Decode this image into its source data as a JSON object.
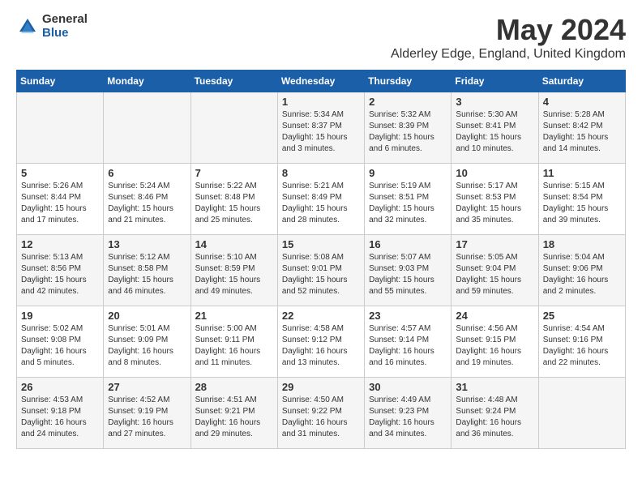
{
  "logo": {
    "general": "General",
    "blue": "Blue"
  },
  "title": "May 2024",
  "location": "Alderley Edge, England, United Kingdom",
  "days_header": [
    "Sunday",
    "Monday",
    "Tuesday",
    "Wednesday",
    "Thursday",
    "Friday",
    "Saturday"
  ],
  "weeks": [
    [
      {
        "num": "",
        "info": ""
      },
      {
        "num": "",
        "info": ""
      },
      {
        "num": "",
        "info": ""
      },
      {
        "num": "1",
        "info": "Sunrise: 5:34 AM\nSunset: 8:37 PM\nDaylight: 15 hours\nand 3 minutes."
      },
      {
        "num": "2",
        "info": "Sunrise: 5:32 AM\nSunset: 8:39 PM\nDaylight: 15 hours\nand 6 minutes."
      },
      {
        "num": "3",
        "info": "Sunrise: 5:30 AM\nSunset: 8:41 PM\nDaylight: 15 hours\nand 10 minutes."
      },
      {
        "num": "4",
        "info": "Sunrise: 5:28 AM\nSunset: 8:42 PM\nDaylight: 15 hours\nand 14 minutes."
      }
    ],
    [
      {
        "num": "5",
        "info": "Sunrise: 5:26 AM\nSunset: 8:44 PM\nDaylight: 15 hours\nand 17 minutes."
      },
      {
        "num": "6",
        "info": "Sunrise: 5:24 AM\nSunset: 8:46 PM\nDaylight: 15 hours\nand 21 minutes."
      },
      {
        "num": "7",
        "info": "Sunrise: 5:22 AM\nSunset: 8:48 PM\nDaylight: 15 hours\nand 25 minutes."
      },
      {
        "num": "8",
        "info": "Sunrise: 5:21 AM\nSunset: 8:49 PM\nDaylight: 15 hours\nand 28 minutes."
      },
      {
        "num": "9",
        "info": "Sunrise: 5:19 AM\nSunset: 8:51 PM\nDaylight: 15 hours\nand 32 minutes."
      },
      {
        "num": "10",
        "info": "Sunrise: 5:17 AM\nSunset: 8:53 PM\nDaylight: 15 hours\nand 35 minutes."
      },
      {
        "num": "11",
        "info": "Sunrise: 5:15 AM\nSunset: 8:54 PM\nDaylight: 15 hours\nand 39 minutes."
      }
    ],
    [
      {
        "num": "12",
        "info": "Sunrise: 5:13 AM\nSunset: 8:56 PM\nDaylight: 15 hours\nand 42 minutes."
      },
      {
        "num": "13",
        "info": "Sunrise: 5:12 AM\nSunset: 8:58 PM\nDaylight: 15 hours\nand 46 minutes."
      },
      {
        "num": "14",
        "info": "Sunrise: 5:10 AM\nSunset: 8:59 PM\nDaylight: 15 hours\nand 49 minutes."
      },
      {
        "num": "15",
        "info": "Sunrise: 5:08 AM\nSunset: 9:01 PM\nDaylight: 15 hours\nand 52 minutes."
      },
      {
        "num": "16",
        "info": "Sunrise: 5:07 AM\nSunset: 9:03 PM\nDaylight: 15 hours\nand 55 minutes."
      },
      {
        "num": "17",
        "info": "Sunrise: 5:05 AM\nSunset: 9:04 PM\nDaylight: 15 hours\nand 59 minutes."
      },
      {
        "num": "18",
        "info": "Sunrise: 5:04 AM\nSunset: 9:06 PM\nDaylight: 16 hours\nand 2 minutes."
      }
    ],
    [
      {
        "num": "19",
        "info": "Sunrise: 5:02 AM\nSunset: 9:08 PM\nDaylight: 16 hours\nand 5 minutes."
      },
      {
        "num": "20",
        "info": "Sunrise: 5:01 AM\nSunset: 9:09 PM\nDaylight: 16 hours\nand 8 minutes."
      },
      {
        "num": "21",
        "info": "Sunrise: 5:00 AM\nSunset: 9:11 PM\nDaylight: 16 hours\nand 11 minutes."
      },
      {
        "num": "22",
        "info": "Sunrise: 4:58 AM\nSunset: 9:12 PM\nDaylight: 16 hours\nand 13 minutes."
      },
      {
        "num": "23",
        "info": "Sunrise: 4:57 AM\nSunset: 9:14 PM\nDaylight: 16 hours\nand 16 minutes."
      },
      {
        "num": "24",
        "info": "Sunrise: 4:56 AM\nSunset: 9:15 PM\nDaylight: 16 hours\nand 19 minutes."
      },
      {
        "num": "25",
        "info": "Sunrise: 4:54 AM\nSunset: 9:16 PM\nDaylight: 16 hours\nand 22 minutes."
      }
    ],
    [
      {
        "num": "26",
        "info": "Sunrise: 4:53 AM\nSunset: 9:18 PM\nDaylight: 16 hours\nand 24 minutes."
      },
      {
        "num": "27",
        "info": "Sunrise: 4:52 AM\nSunset: 9:19 PM\nDaylight: 16 hours\nand 27 minutes."
      },
      {
        "num": "28",
        "info": "Sunrise: 4:51 AM\nSunset: 9:21 PM\nDaylight: 16 hours\nand 29 minutes."
      },
      {
        "num": "29",
        "info": "Sunrise: 4:50 AM\nSunset: 9:22 PM\nDaylight: 16 hours\nand 31 minutes."
      },
      {
        "num": "30",
        "info": "Sunrise: 4:49 AM\nSunset: 9:23 PM\nDaylight: 16 hours\nand 34 minutes."
      },
      {
        "num": "31",
        "info": "Sunrise: 4:48 AM\nSunset: 9:24 PM\nDaylight: 16 hours\nand 36 minutes."
      },
      {
        "num": "",
        "info": ""
      }
    ]
  ]
}
